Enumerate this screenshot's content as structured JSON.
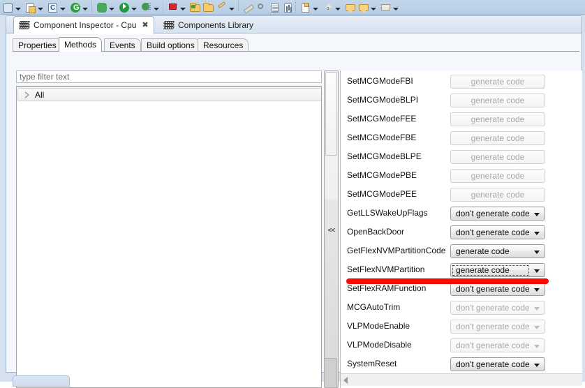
{
  "toolbar": {
    "items": [
      {
        "name": "save-icon",
        "glyph": "sq",
        "arrow": true
      },
      {
        "name": "new-c-file-icon",
        "glyph": "doc",
        "arrow": true
      },
      {
        "name": "c-project-icon",
        "glyph": "csq",
        "arrow": true
      },
      {
        "name": "refresh-icon",
        "glyph": "green-circ",
        "arrow": true
      },
      {
        "name": "debug-bug-icon",
        "glyph": "bug",
        "arrow": true,
        "sep_before": true
      },
      {
        "name": "run-icon",
        "glyph": "play",
        "arrow": true
      },
      {
        "name": "external-tools-icon",
        "glyph": "run-list",
        "arrow": true
      },
      {
        "name": "processor-expert-icon",
        "glyph": "red-chip",
        "arrow": true,
        "sep_before": true
      },
      {
        "name": "open-folder-icon",
        "glyph": "folder-green",
        "arrow": false
      },
      {
        "name": "open-resource-icon",
        "glyph": "folder",
        "arrow": false
      },
      {
        "name": "build-icon",
        "glyph": "hammer",
        "arrow": true
      },
      {
        "name": "clean-icon",
        "glyph": "brush",
        "arrow": false,
        "sep_before": true
      },
      {
        "name": "search-icon",
        "glyph": "magnifier",
        "arrow": false
      },
      {
        "name": "outline-icon",
        "glyph": "page",
        "arrow": false
      },
      {
        "name": "chart-icon",
        "glyph": "bars",
        "arrow": false
      },
      {
        "name": "task-icon",
        "glyph": "checklist",
        "arrow": true,
        "sep_before": true
      },
      {
        "name": "up-arrow-icon",
        "glyph": "up",
        "arrow": true
      },
      {
        "name": "back-annotation-icon",
        "glyph": "callout",
        "arrow": false
      },
      {
        "name": "forward-annotation-icon",
        "glyph": "callout",
        "arrow": true
      },
      {
        "name": "next-icon",
        "glyph": "arrow-right",
        "arrow": true
      }
    ]
  },
  "outer_tabs": [
    {
      "label": "Component Inspector - Cpu",
      "icon": "component-icon",
      "active": true,
      "closable": true
    },
    {
      "label": "Components Library",
      "icon": "component-icon",
      "active": false,
      "closable": false
    }
  ],
  "inner_tabs": [
    {
      "label": "Properties",
      "active": false
    },
    {
      "label": "Methods",
      "active": true
    },
    {
      "label": "Events",
      "active": false
    },
    {
      "label": "Build options",
      "active": false
    },
    {
      "label": "Resources",
      "active": false
    }
  ],
  "filter": {
    "value": "type filter text",
    "placeholder": "type filter text"
  },
  "tree": {
    "root_label": "All",
    "expander": "collapsed-triangle-icon"
  },
  "sash": {
    "collapse_label": "<<"
  },
  "methods": [
    {
      "name": "SetMCGModeFBI",
      "value": "generate code",
      "control": "button",
      "state": "disabled"
    },
    {
      "name": "SetMCGModeBLPI",
      "value": "generate code",
      "control": "button",
      "state": "disabled"
    },
    {
      "name": "SetMCGModeFEE",
      "value": "generate code",
      "control": "button",
      "state": "disabled"
    },
    {
      "name": "SetMCGModeFBE",
      "value": "generate code",
      "control": "button",
      "state": "disabled"
    },
    {
      "name": "SetMCGModeBLPE",
      "value": "generate code",
      "control": "button",
      "state": "disabled"
    },
    {
      "name": "SetMCGModePBE",
      "value": "generate code",
      "control": "button",
      "state": "disabled"
    },
    {
      "name": "SetMCGModePEE",
      "value": "generate code",
      "control": "button",
      "state": "disabled"
    },
    {
      "name": "GetLLSWakeUpFlags",
      "value": "don't generate code",
      "control": "dropdown",
      "state": "enabled"
    },
    {
      "name": "OpenBackDoor",
      "value": "don't generate code",
      "control": "dropdown",
      "state": "enabled"
    },
    {
      "name": "GetFlexNVMPartitionCode",
      "value": "generate code",
      "control": "dropdown",
      "state": "enabled"
    },
    {
      "name": "SetFlexNVMPartition",
      "value": "generate code",
      "control": "dropdown",
      "state": "focused"
    },
    {
      "name": "SetFlexRAMFunction",
      "value": "don't generate code",
      "control": "dropdown",
      "state": "enabled"
    },
    {
      "name": "MCGAutoTrim",
      "value": "don't generate code",
      "control": "dropdown",
      "state": "disabled"
    },
    {
      "name": "VLPModeEnable",
      "value": "don't generate code",
      "control": "dropdown",
      "state": "disabled"
    },
    {
      "name": "VLPModeDisable",
      "value": "don't generate code",
      "control": "dropdown",
      "state": "disabled"
    },
    {
      "name": "SystemReset",
      "value": "don't generate code",
      "control": "dropdown",
      "state": "enabled"
    }
  ],
  "dropdown_options": [
    "generate code",
    "don't generate code"
  ],
  "annotation": {
    "name": "red-highlight-line",
    "color": "#fb0a02"
  },
  "scrollbars": {
    "horizontal_left_arrow": "scroll-left-arrow-icon"
  }
}
